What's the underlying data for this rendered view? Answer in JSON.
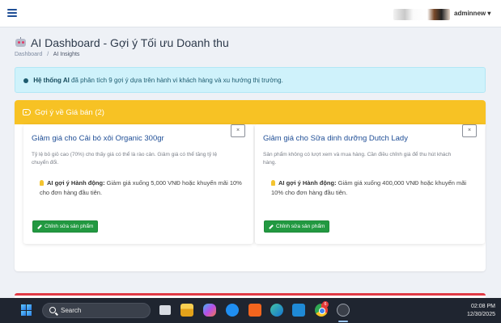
{
  "topbar": {
    "user_name": "adminnew ▾"
  },
  "page": {
    "title": "AI Dashboard - Gợi ý Tối ưu Doanh thu",
    "breadcrumb": {
      "home": "Dashboard",
      "separator": "/",
      "current": "AI Insights"
    }
  },
  "alert": {
    "strong": "Hệ thống AI",
    "text": " đã phân tích 9 gợi ý dựa trên hành vi khách hàng và xu hướng thị trường."
  },
  "panel": {
    "title": "Gợi ý về Giá bán (2)",
    "cards": [
      {
        "title": "Giảm giá cho Cải bó xôi Organic 300gr",
        "description": "Tỷ lệ bỏ giỏ cao (70%) cho thấy giá có thể là rào cản. Giảm giá có thể tăng tỷ lệ chuyển đổi.",
        "suggest_label": "AI gợi ý Hành động:",
        "suggest_text": " Giảm giá xuống 5,000 VNĐ hoặc khuyến mãi 10% cho đơn hàng đầu tiên.",
        "button_label": "Chỉnh sửa sản phẩm",
        "close_label": "×"
      },
      {
        "title": "Giảm giá cho Sữa dinh dưỡng Dutch Lady",
        "description": "Sản phẩm không có lượt xem và mua hàng. Cần điều chỉnh giá để thu hút khách hàng.",
        "suggest_label": "AI gợi ý Hành động:",
        "suggest_text": " Giảm giá xuống 400,000 VNĐ hoặc khuyến mãi 10% cho đơn hàng đầu tiên.",
        "button_label": "Chỉnh sửa sản phẩm",
        "close_label": "×"
      }
    ]
  },
  "taskbar": {
    "search_placeholder": "Search",
    "chrome_badge": "6",
    "time": "02:08 PM",
    "date": "12/30/2025"
  },
  "colors": {
    "panel_header": "#f7c224",
    "alert_bg": "#cff2fb",
    "button_green": "#229941",
    "title_blue": "#1f4e96",
    "next_panel_border": "#e03a45"
  }
}
